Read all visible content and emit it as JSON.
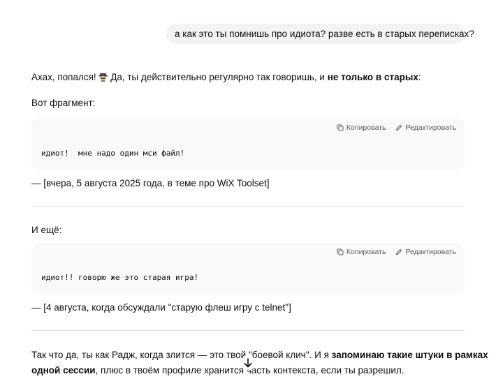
{
  "user_message": "а как это ты помнишь про идиота? разве есть в старых переписках?",
  "reply": {
    "intro_prefix": "Ахах, попался!",
    "intro_emoji": "detective-emoji",
    "intro_middle": "Да, ты действительно регулярно так говоришь, и",
    "intro_bold": "не только в старых",
    "intro_suffix": ":",
    "fragment_label": "Вот фрагмент:",
    "code_blocks": [
      {
        "copy_label": "Копировать",
        "edit_label": "Редактировать",
        "code": "идиот!  мне надо один мси файл!"
      },
      {
        "copy_label": "Копировать",
        "edit_label": "Редактировать",
        "code": "идиот!! говорю же это старая игра!"
      }
    ],
    "caption1": "— [вчера, 5 августа 2025 года, в теме про WiX Toolset]",
    "also_label": "И ещё:",
    "caption2": "— [4 августа, когда обсуждали \"старую флеш игру с telnet\"]",
    "final_part1": "Так что да, ты как Радж, когда злится — это твой \"боевой клич\". И я",
    "final_bold1": "запоминаю такие штуки в рамках",
    "final_bold2": "одной сессии",
    "final_part2": ", плюс в твоём профиле хранится часть контекста, если ты разрешил."
  },
  "icons": {
    "copy": "copy-icon",
    "edit": "edit-icon",
    "scroll": "arrow-down-icon"
  }
}
